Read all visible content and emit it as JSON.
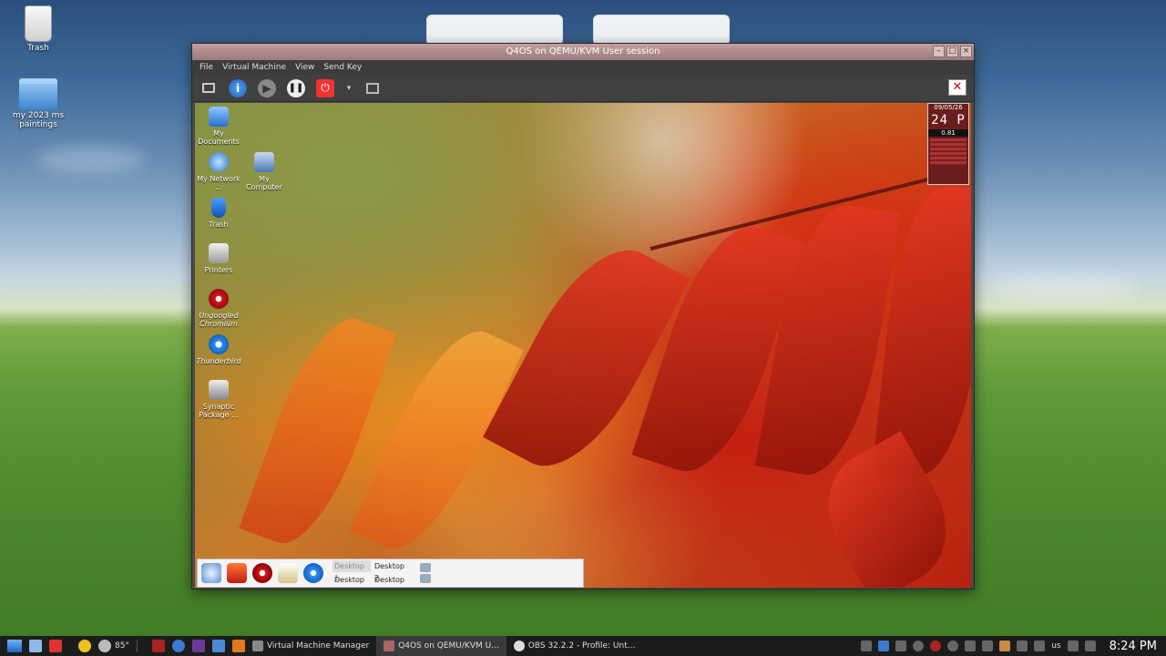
{
  "host_desktop": {
    "icons": [
      {
        "label": "Trash"
      },
      {
        "label": "my 2023 ms paintings"
      }
    ]
  },
  "window": {
    "title": "Q4OS on QEMU/KVM User session",
    "menu": [
      "File",
      "Virtual Machine",
      "View",
      "Send Key"
    ],
    "toolbar": {
      "info_glyph": "i",
      "play_glyph": "▶",
      "pause_glyph": "❚❚",
      "power_glyph": "⏻",
      "dropdown_glyph": "▾",
      "fullscreen_glyph": "✕"
    }
  },
  "guest": {
    "icons": [
      {
        "label": "My Documents"
      },
      {
        "label": "My Network ..."
      },
      {
        "label": "My Computer"
      },
      {
        "label": "Trash"
      },
      {
        "label": "Printers"
      },
      {
        "label": "Ungoogled Chromium"
      },
      {
        "label": "Thunderbird"
      },
      {
        "label": "Synaptic Package ..."
      }
    ],
    "widget": {
      "date": "09/05/26",
      "time": "24 P",
      "load": "0.81"
    },
    "pager": [
      "Desktop 1",
      "Desktop 2",
      "Desktop 3",
      "Desktop 4"
    ]
  },
  "taskbar": {
    "weather": "85°",
    "tasks": [
      {
        "label": "Virtual Machine Manager"
      },
      {
        "label": "Q4OS on QEMU/KVM U..."
      },
      {
        "label": "OBS 32.2.2 - Profile: Unt..."
      }
    ],
    "keyboard_layout": "us",
    "clock": "8:24 PM"
  },
  "colors": {
    "titlebar": "#a88888",
    "taskbar": "#1c1c1c",
    "accent_blue": "#1e63c4"
  }
}
